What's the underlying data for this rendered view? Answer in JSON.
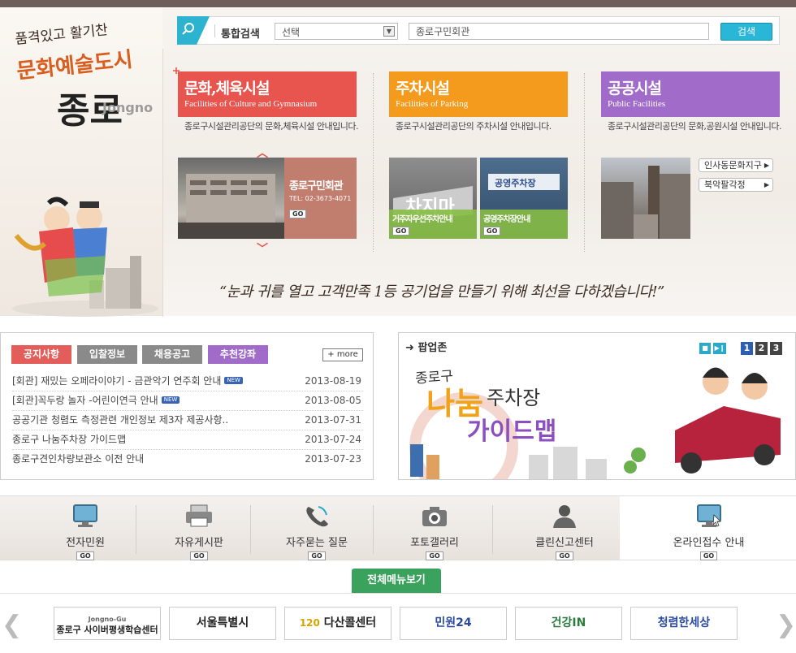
{
  "header": {
    "slogan_line1": "품격있고 활기찬",
    "slogan_line2": "문화예술도시",
    "slogan_line3": "종로",
    "slogan_en": "Jongno"
  },
  "search": {
    "label": "통합검색",
    "select_value": "선택",
    "input_value": "종로구민회관",
    "button_label": "검색"
  },
  "categories": [
    {
      "title": "문화,체육시설",
      "subtitle": "Facilities of Culture and Gymnasium",
      "desc": "종로구시설관리공단의 문화,체육시설 안내입니다.",
      "color": "#e8554e"
    },
    {
      "title": "주차시설",
      "subtitle": "Facilities of Parking",
      "desc": "종로구시설관리공단의 주차시설 안내입니다.",
      "color": "#f49a1c"
    },
    {
      "title": "공공시설",
      "subtitle": "Public Facilities",
      "desc": "종로구시설관리공단의 문화,공원시설 안내입니다.",
      "color": "#a06bc9"
    }
  ],
  "cards": {
    "culture": {
      "title": "종로구민회관",
      "tel": "TEL: 02-3673-4071",
      "go": "GO"
    },
    "parking1": {
      "title": "거주자우선주차안내",
      "go": "GO"
    },
    "parking2": {
      "title": "공영주차장안내",
      "go": "GO"
    },
    "public_links": [
      "인사동문화지구",
      "북악팔각정"
    ]
  },
  "quote": "“눈과 귀를 열고 고객만족 1등 공기업을 만들기 위해 최선을 다하겠습니다!”",
  "notice": {
    "tabs": [
      {
        "label": "공지사항",
        "color": "#e35d5b"
      },
      {
        "label": "입찰정보",
        "color": "#8a8a8a"
      },
      {
        "label": "채용공고",
        "color": "#8a8a8a"
      },
      {
        "label": "추천강좌",
        "color": "#a06bc9"
      }
    ],
    "more_label": "more",
    "items": [
      {
        "title": "[회관] 재밌는 오페라이야기 - 금관악기 연주회 안내",
        "date": "2013-08-19",
        "new": "NEW"
      },
      {
        "title": "[회관]꼭두랑 놀자 -어린이연극 안내",
        "date": "2013-08-05",
        "new": "NEW"
      },
      {
        "title": "공공기관 청렴도 측정관련 개인정보 제3자 제공사항..",
        "date": "2013-07-31",
        "new": ""
      },
      {
        "title": "종로구 나눔주차장 가이드맵",
        "date": "2013-07-24",
        "new": ""
      },
      {
        "title": "종로구견인차량보관소 이전 안내",
        "date": "2013-07-23",
        "new": ""
      }
    ]
  },
  "popup": {
    "title": "팝업존",
    "pages": [
      "1",
      "2",
      "3"
    ],
    "line1": "종로구",
    "line2": "나눔",
    "line3": "주차장",
    "line4": "가이드맵"
  },
  "services": [
    {
      "label": "전자민원",
      "icon": "monitor-icon"
    },
    {
      "label": "자유게시판",
      "icon": "printer-icon"
    },
    {
      "label": "자주묻는 질문",
      "icon": "phone-icon"
    },
    {
      "label": "포토갤러리",
      "icon": "camera-icon"
    },
    {
      "label": "클린신고센터",
      "icon": "person-icon"
    },
    {
      "label": "온라인접수 안내",
      "icon": "monitor-icon"
    }
  ],
  "go_label": "GO",
  "fullmenu_label": "전체메뉴보기",
  "banners": [
    {
      "label": "종로구 사이버평생학습센터",
      "sub": "Jongno-Gu",
      "color": "#222"
    },
    {
      "label": "서울특별시",
      "color": "#222"
    },
    {
      "label": "다산콜센터",
      "sub": "120",
      "color": "#222"
    },
    {
      "label": "민원24",
      "color": "#2a4aa0"
    },
    {
      "label": "건강IN",
      "color": "#2a7c3a"
    },
    {
      "label": "청렴한세상",
      "color": "#2a4aa0"
    }
  ]
}
